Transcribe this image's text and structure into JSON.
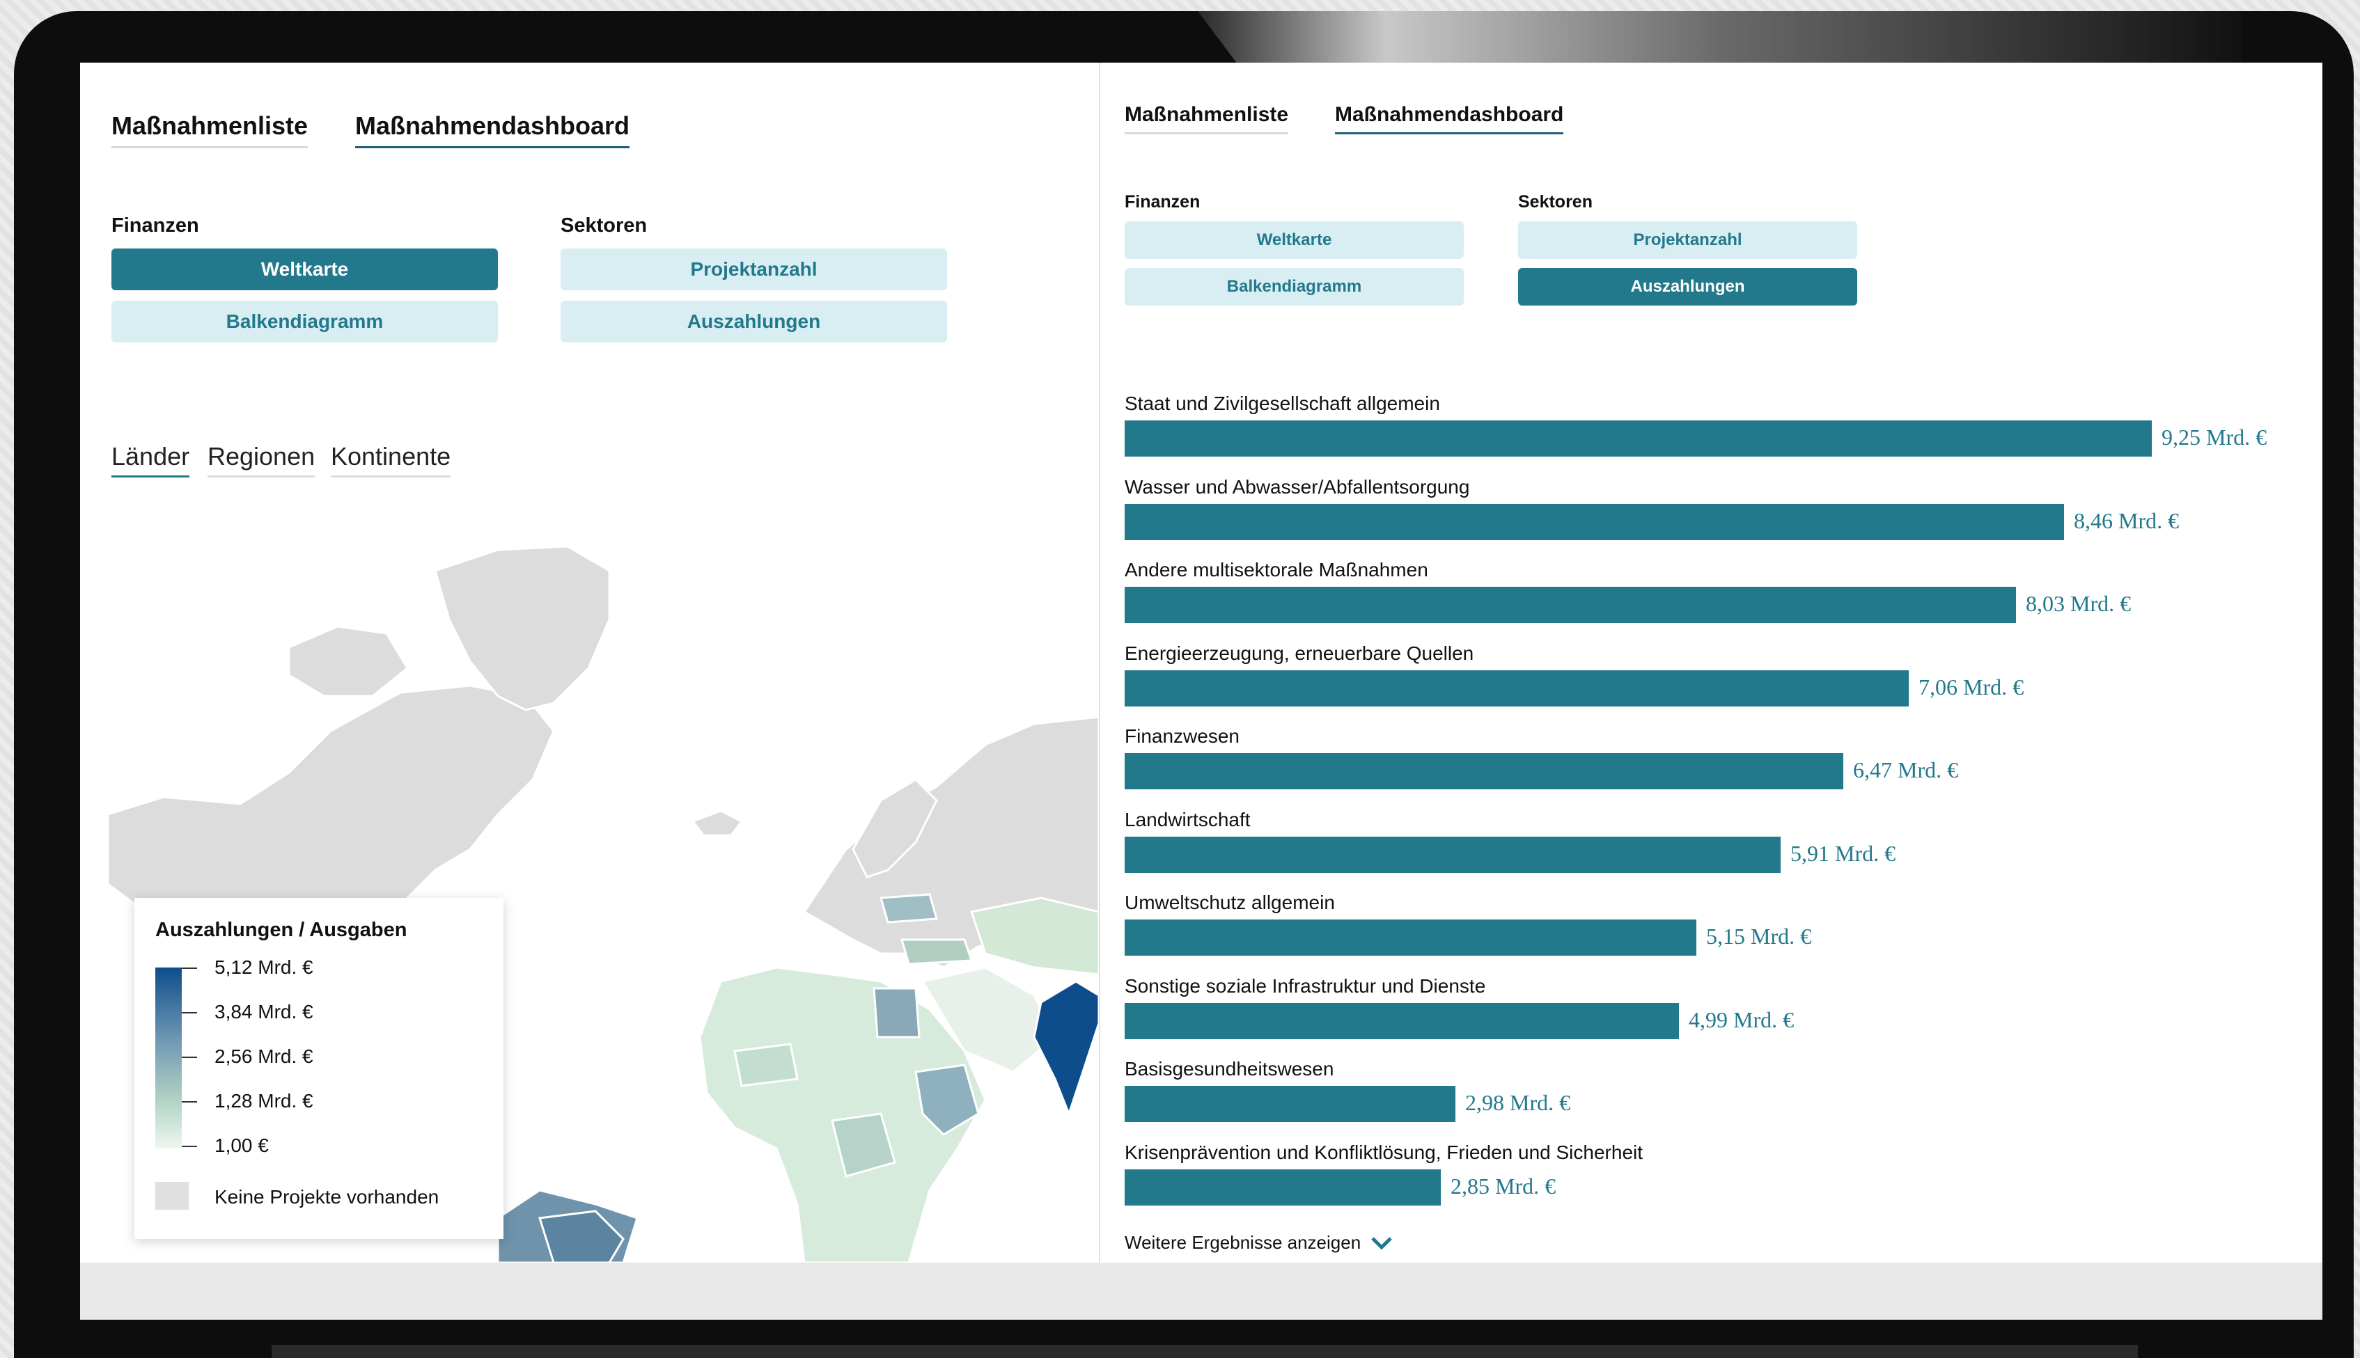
{
  "left": {
    "tabs": [
      "Maßnahmenliste",
      "Maßnahmendashboard"
    ],
    "finanzen_label": "Finanzen",
    "sektoren_label": "Sektoren",
    "buttons": {
      "weltkarte": "Weltkarte",
      "balkendiagramm": "Balkendiagramm",
      "projektanzahl": "Projektanzahl",
      "auszahlungen": "Auszahlungen"
    },
    "active_button": "Weltkarte",
    "subtabs": [
      "Länder",
      "Regionen",
      "Kontinente"
    ],
    "active_subtab": "Länder",
    "legend": {
      "title": "Auszahlungen / Ausgaben",
      "values": [
        "5,12 Mrd. €",
        "3,84 Mrd. €",
        "2,56 Mrd. €",
        "1,28 Mrd. €",
        "1,00 €"
      ],
      "no_data": "Keine Projekte vorhanden",
      "colors": {
        "high": "#0e4d8c",
        "low": "#eef7ee",
        "none": "#e0e0e0"
      }
    }
  },
  "right": {
    "tabs": [
      "Maßnahmenliste",
      "Maßnahmendashboard"
    ],
    "finanzen_label": "Finanzen",
    "sektoren_label": "Sektoren",
    "buttons": {
      "weltkarte": "Weltkarte",
      "balkendiagramm": "Balkendiagramm",
      "projektanzahl": "Projektanzahl",
      "auszahlungen": "Auszahlungen"
    },
    "active_button": "Auszahlungen",
    "more_link": "Weitere Ergebnisse anzeigen"
  },
  "chart_data": {
    "type": "bar",
    "orientation": "horizontal",
    "unit": "Mrd. €",
    "categories": [
      "Staat und Zivilgesellschaft allgemein",
      "Wasser und Abwasser/Abfallentsorgung",
      "Andere multisektorale Maßnahmen",
      "Energieerzeugung, erneuerbare Quellen",
      "Finanzwesen",
      "Landwirtschaft",
      "Umweltschutz allgemein",
      "Sonstige soziale Infrastruktur und Dienste",
      "Basisgesundheitswesen",
      "Krisenprävention und Konfliktlösung, Frieden und Sicherheit"
    ],
    "values": [
      9.25,
      8.46,
      8.03,
      7.06,
      6.47,
      5.91,
      5.15,
      4.99,
      2.98,
      2.85
    ],
    "labels": [
      "9,25 Mrd. €",
      "8,46 Mrd. €",
      "8,03 Mrd. €",
      "7,06 Mrd. €",
      "6,47 Mrd. €",
      "5,91 Mrd. €",
      "5,15 Mrd. €",
      "4,99 Mrd. €",
      "2,98 Mrd. €",
      "2,85 Mrd. €"
    ],
    "color": "#23798c"
  }
}
